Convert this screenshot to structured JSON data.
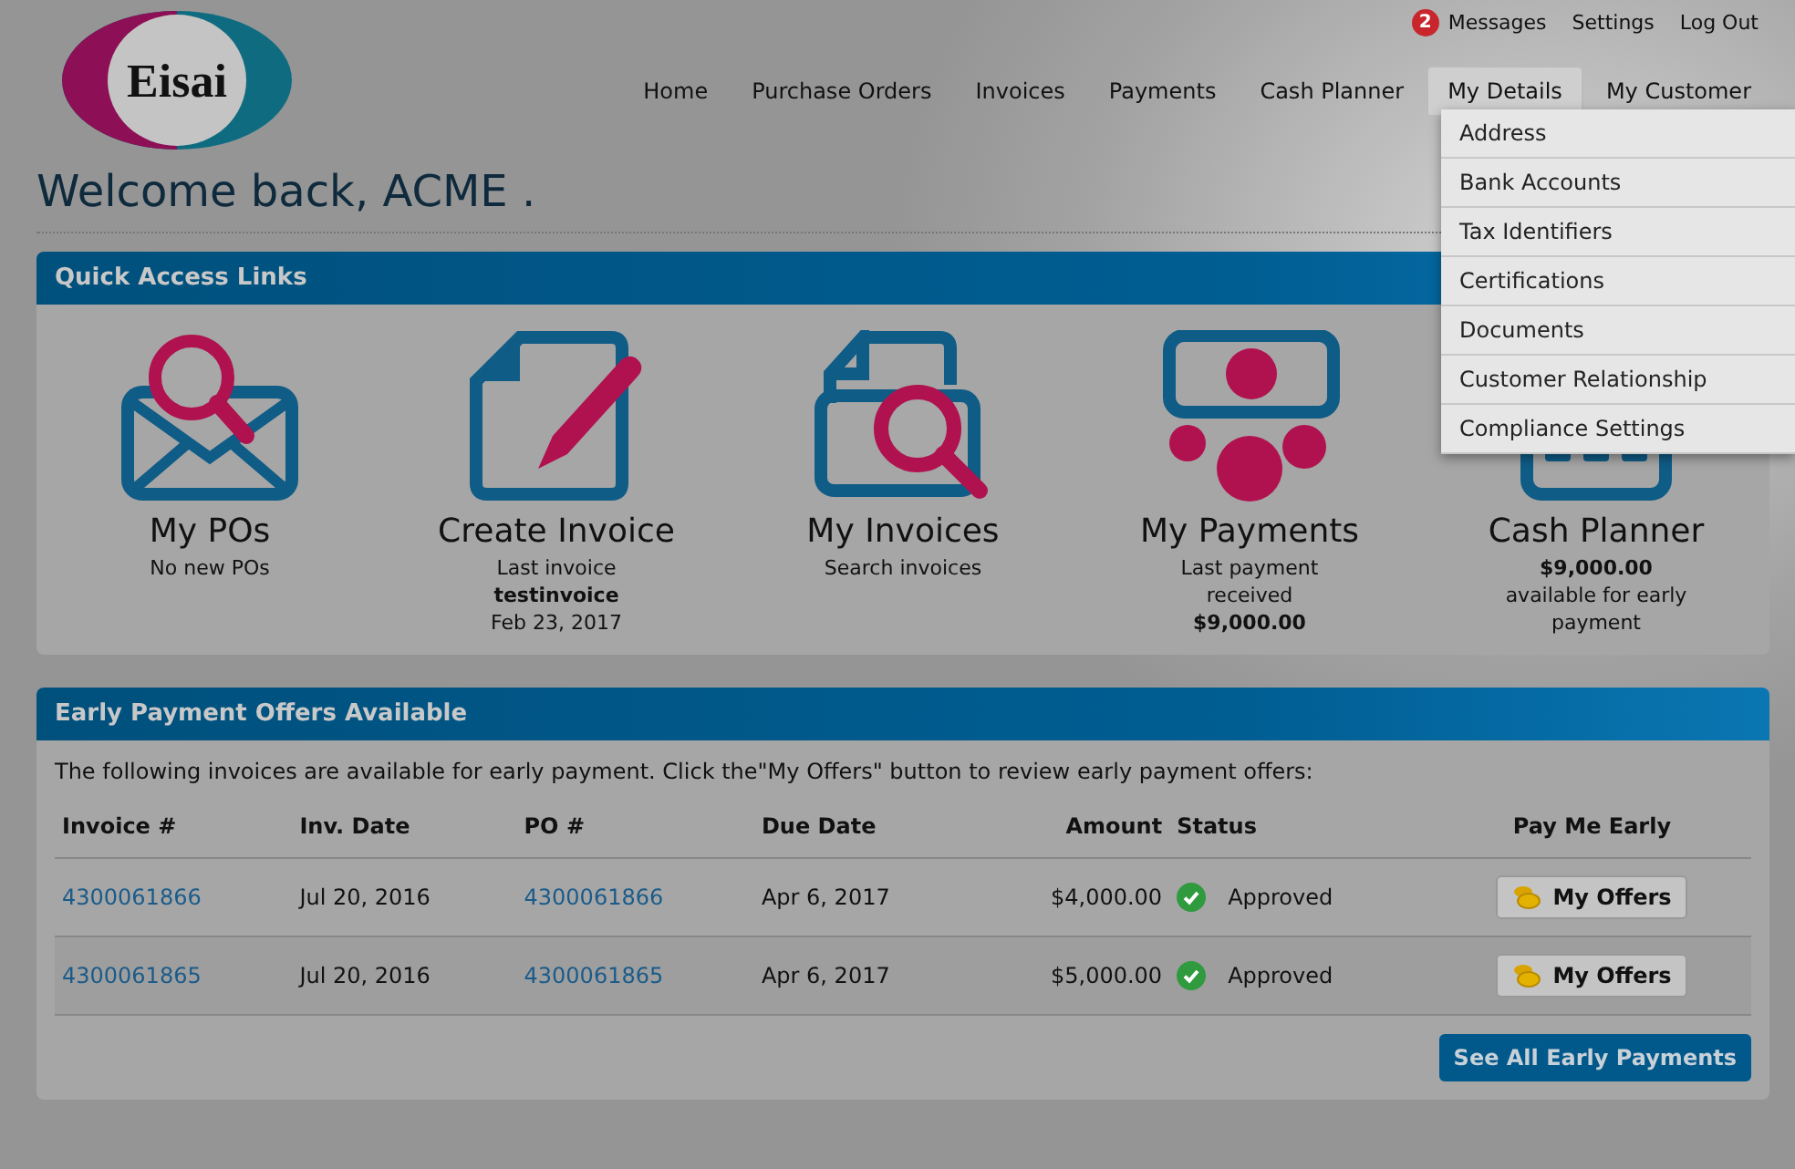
{
  "logo": {
    "text": "Eisai"
  },
  "top_links": [
    {
      "label": "Messages",
      "badge": "2"
    },
    {
      "label": "Settings"
    },
    {
      "label": "Log Out"
    }
  ],
  "nav": [
    {
      "label": "Home",
      "selected": false
    },
    {
      "label": "Purchase Orders",
      "selected": false
    },
    {
      "label": "Invoices",
      "selected": false
    },
    {
      "label": "Payments",
      "selected": false
    },
    {
      "label": "Cash Planner",
      "selected": false
    },
    {
      "label": "My Details",
      "selected": true
    },
    {
      "label": "My Customer",
      "selected": false
    }
  ],
  "dropdown": [
    "Address",
    "Bank Accounts",
    "Tax Identifiers",
    "Certifications",
    "Documents",
    "Customer Relationship",
    "Compliance Settings"
  ],
  "welcome": "Welcome back, ACME .",
  "quick_access": {
    "title": "Quick Access Links",
    "cards": [
      {
        "title": "My POs",
        "lines": [
          {
            "text": "No new POs",
            "bold": false
          }
        ]
      },
      {
        "title": "Create Invoice",
        "lines": [
          {
            "text": "Last invoice",
            "bold": false
          },
          {
            "text": "testinvoice",
            "bold": true
          },
          {
            "text": "Feb 23, 2017",
            "bold": false
          }
        ]
      },
      {
        "title": "My Invoices",
        "lines": [
          {
            "text": "Search invoices",
            "bold": false
          }
        ]
      },
      {
        "title": "My Payments",
        "lines": [
          {
            "text": "Last payment",
            "bold": false
          },
          {
            "text": "received",
            "bold": false
          },
          {
            "text": "$9,000.00",
            "bold": true
          }
        ]
      },
      {
        "title": "Cash Planner",
        "lines": [
          {
            "text": "$9,000.00",
            "bold": true
          },
          {
            "text": "available for early",
            "bold": false
          },
          {
            "text": "payment",
            "bold": false
          }
        ]
      }
    ]
  },
  "early_payment": {
    "title": "Early Payment Offers Available",
    "intro": "The following invoices are available for early payment. Click the\"My Offers\" button to review early payment offers:",
    "columns": [
      "Invoice #",
      "Inv. Date",
      "PO #",
      "Due Date",
      "Amount",
      "Status",
      "Pay Me Early"
    ],
    "rows": [
      {
        "invoice": "4300061866",
        "inv_date": "Jul 20, 2016",
        "po": "4300061866",
        "due_date": "Apr 6, 2017",
        "amount": "$4,000.00",
        "status": "Approved",
        "action": "My Offers"
      },
      {
        "invoice": "4300061865",
        "inv_date": "Jul 20, 2016",
        "po": "4300061865",
        "due_date": "Apr 6, 2017",
        "amount": "$5,000.00",
        "status": "Approved",
        "action": "My Offers"
      }
    ],
    "footer_button": "See All Early Payments"
  }
}
